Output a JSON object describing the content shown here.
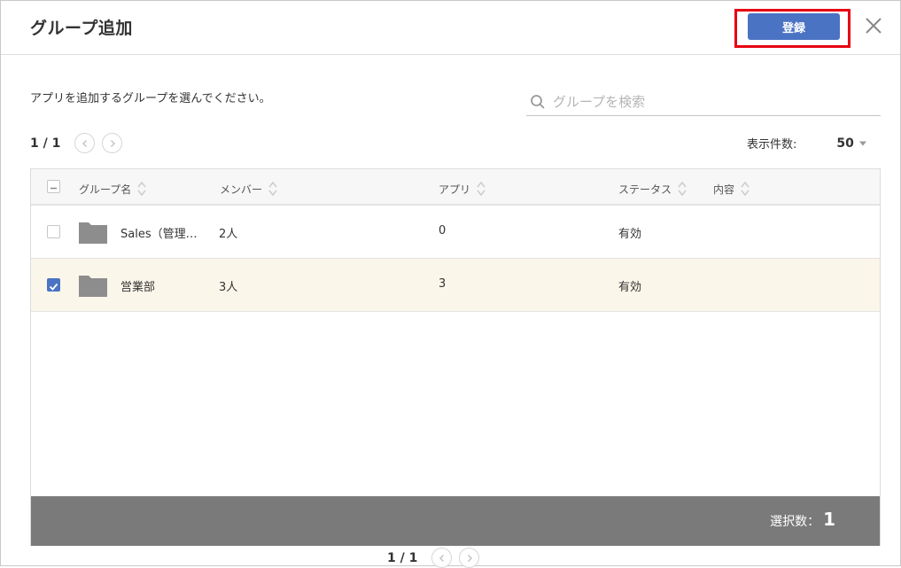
{
  "dialog": {
    "title": "グループ追加",
    "register_label": "登録",
    "instruction": "アプリを追加するグループを選んでください。",
    "search": {
      "placeholder": "グループを検索"
    },
    "pager_top": {
      "text": "1 / 1"
    },
    "pager_bottom": {
      "text": "1 / 1"
    },
    "per_page": {
      "label": "表示件数:",
      "value": "50"
    }
  },
  "table": {
    "columns": [
      "グループ名",
      "メンバー",
      "アプリ",
      "ステータス",
      "内容"
    ],
    "rows": [
      {
        "name": "Sales（管理…",
        "members": "2人",
        "apps": "0",
        "status": "有効",
        "content": "",
        "checked": false
      },
      {
        "name": "営業部",
        "members": "3人",
        "apps": "3",
        "status": "有効",
        "content": "",
        "checked": true
      }
    ]
  },
  "footer": {
    "selected_label": "選択数：",
    "selected_count": "1"
  },
  "colors": {
    "primary": "#4b73c4",
    "highlight": "#e60012",
    "footer_bg": "#7a7a7a",
    "selected_row": "#fbf6ea"
  }
}
